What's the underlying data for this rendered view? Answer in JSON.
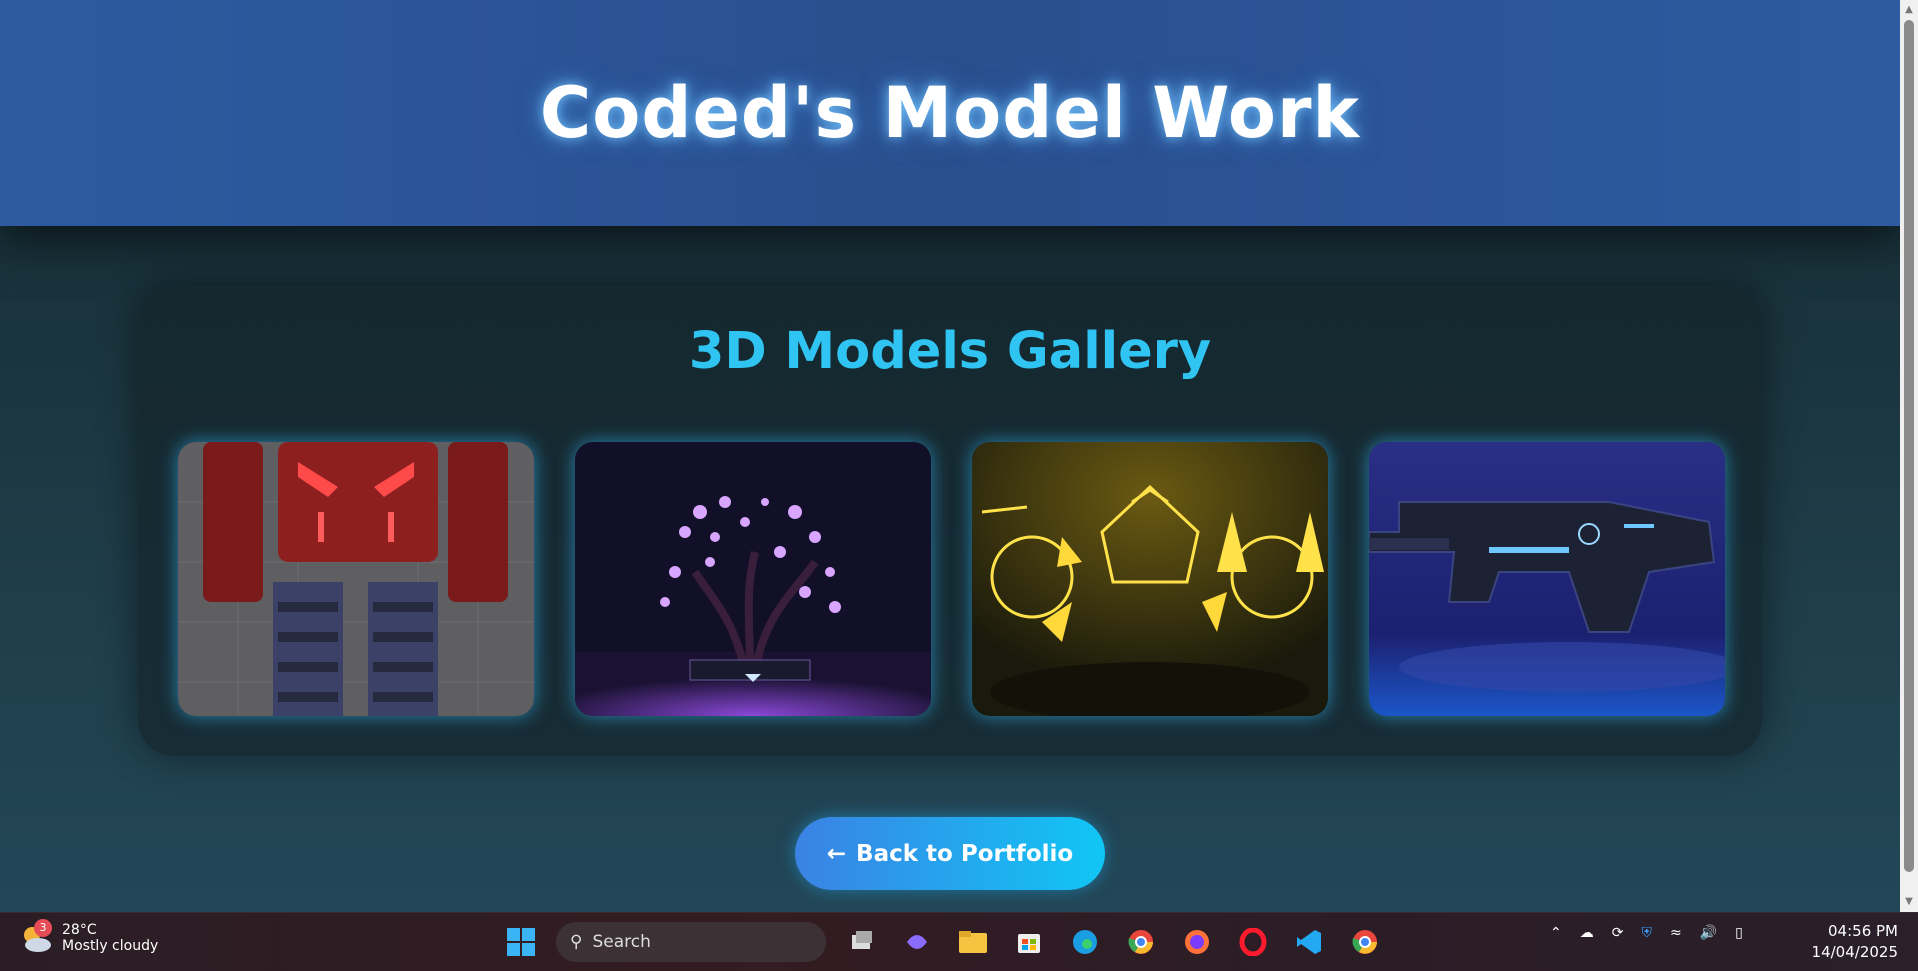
{
  "header": {
    "title": "Coded's Model Work"
  },
  "gallery": {
    "title": "3D Models Gallery",
    "items": [
      {
        "name": "robot-model"
      },
      {
        "name": "bonsai-tree-model"
      },
      {
        "name": "gold-glow-model"
      },
      {
        "name": "sci-fi-gun-model"
      }
    ]
  },
  "back_button": {
    "arrow": "←",
    "label": "Back to Portfolio"
  },
  "taskbar": {
    "weather": {
      "badge": "3",
      "temp": "28°C",
      "condition": "Mostly cloudy"
    },
    "search_placeholder": "Search",
    "clock": {
      "time": "04:56 PM",
      "date": "14/04/2025"
    }
  },
  "colors": {
    "accent": "#2fc4f2",
    "header": "#2d5aa0",
    "button_start": "#3b82e4",
    "button_end": "#10c6f5"
  }
}
